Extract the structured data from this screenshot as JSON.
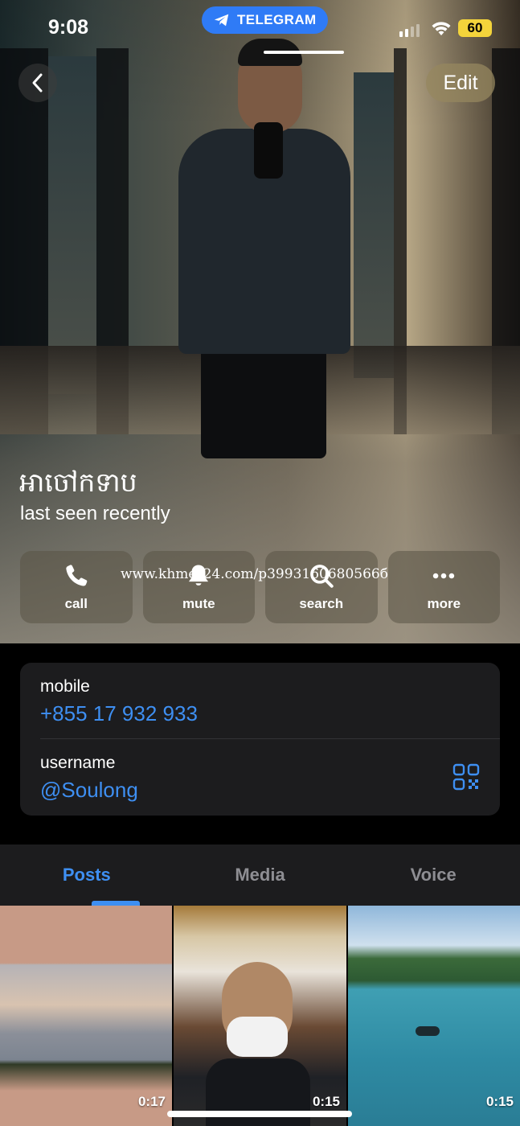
{
  "status_bar": {
    "time": "9:08",
    "app_pill": "TELEGRAM",
    "battery": "60"
  },
  "header": {
    "back_icon": "chevron-left-icon",
    "edit_label": "Edit"
  },
  "profile": {
    "name": "អាចៅកទាប",
    "status": "last seen recently"
  },
  "actions": [
    {
      "label": "call",
      "icon": "phone-icon"
    },
    {
      "label": "mute",
      "icon": "bell-icon"
    },
    {
      "label": "search",
      "icon": "search-icon"
    },
    {
      "label": "more",
      "icon": "more-icon"
    }
  ],
  "watermark": "www.khmer24.com/p3993160680566б",
  "info": {
    "mobile_label": "mobile",
    "mobile_value": "+855 17 932 933",
    "username_label": "username",
    "username_value": "@Soulong"
  },
  "tabs": [
    "Posts",
    "Media",
    "Voice"
  ],
  "active_tab": "Posts",
  "grid": [
    {
      "duration": "0:17"
    },
    {
      "duration": "0:15"
    },
    {
      "duration": "0:15"
    }
  ],
  "colors": {
    "accent": "#3e8ff2",
    "telegram_pill": "#2f7bf6",
    "battery": "#f3d43b",
    "card": "#1c1c1e"
  }
}
